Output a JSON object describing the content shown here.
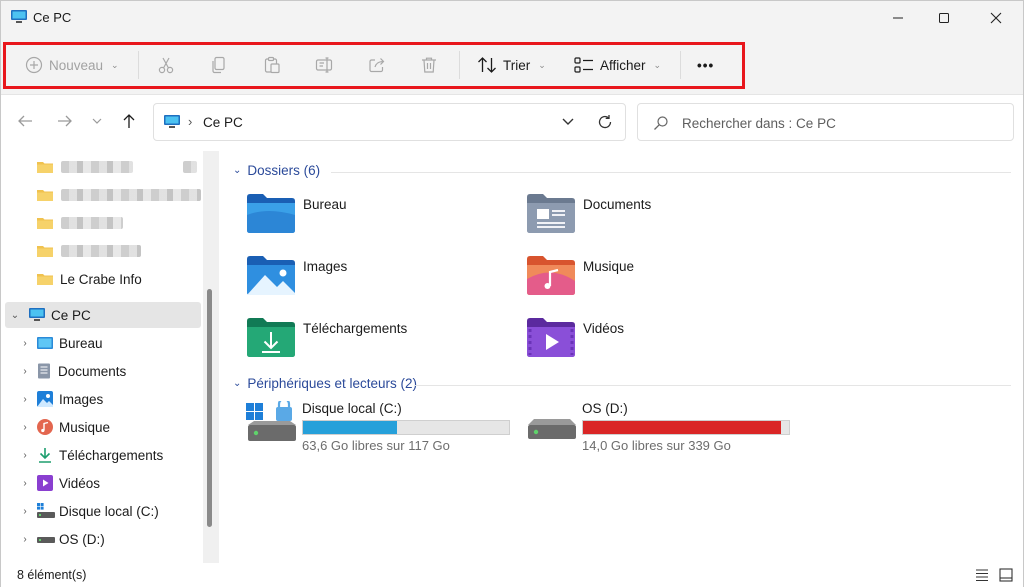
{
  "window": {
    "title": "Ce PC"
  },
  "toolbar": {
    "new_label": "Nouveau",
    "sort_label": "Trier",
    "view_label": "Afficher",
    "more_label": "•••",
    "highlight_color": "#e8161b"
  },
  "address": {
    "crumb": "Ce PC"
  },
  "search": {
    "placeholder": "Rechercher dans : Ce PC"
  },
  "sidebar": {
    "quick_access": [
      {
        "label": "",
        "blurred": true
      },
      {
        "label": "",
        "blurred": true
      },
      {
        "label": "",
        "blurred": true
      },
      {
        "label": "",
        "blurred": true
      },
      {
        "label": "Le Crabe Info",
        "blurred": false
      }
    ],
    "this_pc": "Ce PC",
    "items": [
      {
        "label": "Bureau",
        "icon": "desktop-icon"
      },
      {
        "label": "Documents",
        "icon": "documents-icon"
      },
      {
        "label": "Images",
        "icon": "pictures-icon"
      },
      {
        "label": "Musique",
        "icon": "music-icon"
      },
      {
        "label": "Téléchargements",
        "icon": "downloads-icon"
      },
      {
        "label": "Vidéos",
        "icon": "videos-icon"
      },
      {
        "label": "Disque local (C:)",
        "icon": "local-disk-icon"
      },
      {
        "label": "OS (D:)",
        "icon": "drive-icon"
      }
    ]
  },
  "main": {
    "folders_header": "Dossiers (6)",
    "folders": [
      {
        "label": "Bureau",
        "icon": "desktop-folder-icon"
      },
      {
        "label": "Documents",
        "icon": "documents-folder-icon"
      },
      {
        "label": "Images",
        "icon": "pictures-folder-icon"
      },
      {
        "label": "Musique",
        "icon": "music-folder-icon"
      },
      {
        "label": "Téléchargements",
        "icon": "downloads-folder-icon"
      },
      {
        "label": "Vidéos",
        "icon": "videos-folder-icon"
      }
    ],
    "drives_header": "Périphériques et lecteurs (2)",
    "drives": [
      {
        "label": "Disque local (C:)",
        "free": "63,6 Go libres sur 117 Go",
        "used_fraction": 0.457,
        "bar_color": "#26a0da"
      },
      {
        "label": "OS (D:)",
        "free": "14,0 Go libres sur 339 Go",
        "used_fraction": 0.959,
        "bar_color": "#da2626"
      }
    ]
  },
  "status": {
    "count": "8 élément(s)"
  }
}
